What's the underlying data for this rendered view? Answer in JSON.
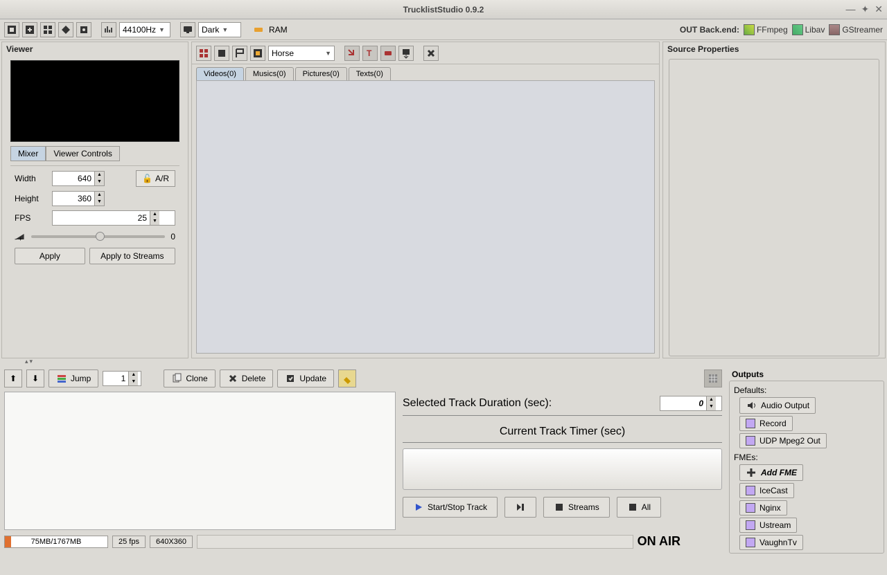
{
  "window": {
    "title": "TrucklistStudio 0.9.2"
  },
  "toolbar": {
    "sample_rate": "44100Hz",
    "theme": "Dark",
    "ram_label": "RAM",
    "backend_label": "OUT Back.end:",
    "backends": {
      "ffmpeg": "FFmpeg",
      "libav": "Libav",
      "gstreamer": "GStreamer"
    }
  },
  "viewer": {
    "title": "Viewer",
    "tabs": {
      "mixer": "Mixer",
      "controls": "Viewer Controls"
    },
    "width_label": "Width",
    "width_value": "640",
    "height_label": "Height",
    "height_value": "360",
    "fps_label": "FPS",
    "fps_value": "25",
    "ar_label": "A/R",
    "volume_value": "0",
    "apply": "Apply",
    "apply_streams": "Apply to Streams"
  },
  "center": {
    "preset": "Horse",
    "tabs": {
      "videos": "Videos(0)",
      "musics": "Musics(0)",
      "pictures": "Pictures(0)",
      "texts": "Texts(0)"
    }
  },
  "props": {
    "title": "Source Properties"
  },
  "tracks": {
    "jump_label": "Jump",
    "jump_value": "1",
    "clone": "Clone",
    "delete": "Delete",
    "update": "Update",
    "duration_label": "Selected Track Duration (sec):",
    "duration_value": "0",
    "timer_label": "Current Track Timer (sec)",
    "start_stop": "Start/Stop Track",
    "streams": "Streams",
    "all": "All"
  },
  "status": {
    "mem": "75MB/1767MB",
    "fps": "25 fps",
    "res": "640X360",
    "onair": "ON AIR"
  },
  "outputs": {
    "title": "Outputs",
    "defaults_label": "Defaults:",
    "audio": "Audio Output",
    "record": "Record",
    "udp": "UDP Mpeg2 Out",
    "fmes_label": "FMEs:",
    "add_fme": "Add FME",
    "icecast": "IceCast",
    "nginx": "Nginx",
    "ustream": "Ustream",
    "vaughn": "VaughnTv"
  }
}
